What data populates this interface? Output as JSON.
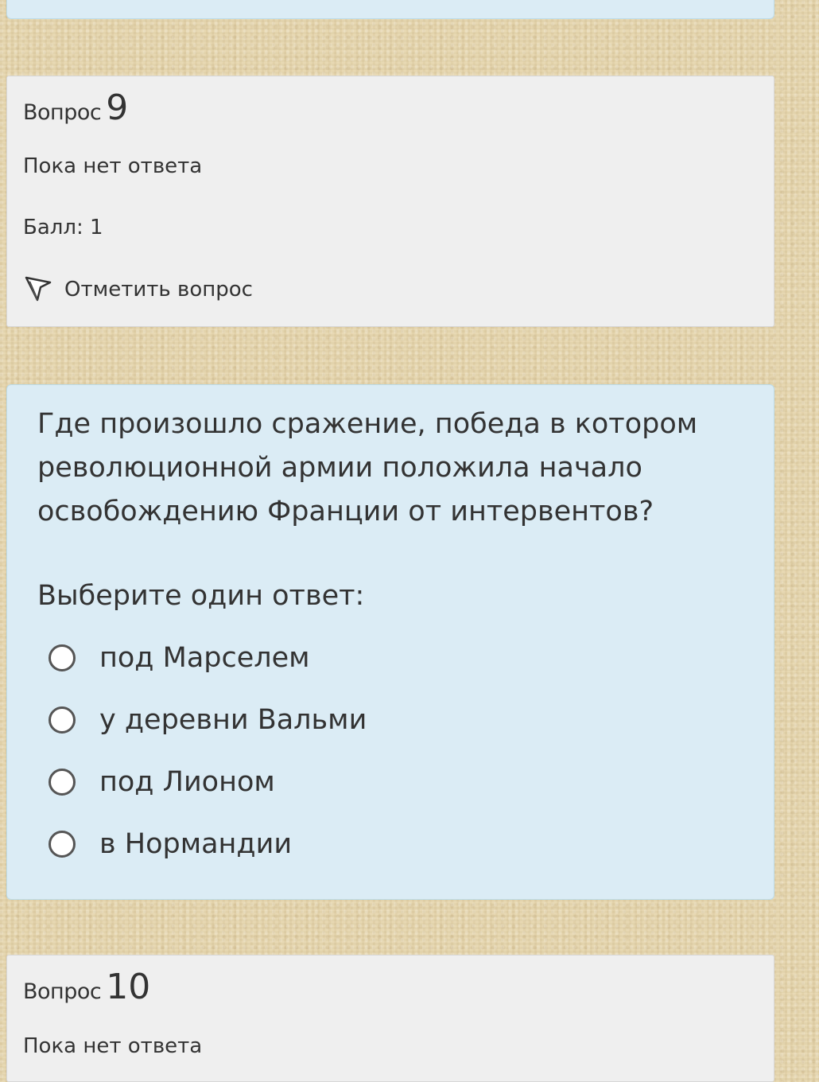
{
  "questions": [
    {
      "title_word": "Вопрос",
      "number": "9",
      "state": "Пока нет ответа",
      "grade": "Балл: 1",
      "flag_label": "Отметить вопрос",
      "text": "Где произошло сражение, победа в котором революционной армии положила начало освобождению Франции от интервентов?",
      "prompt": "Выберите один ответ:",
      "answers": [
        {
          "label": "под Марселем",
          "selected": false
        },
        {
          "label": "у деревни Вальми",
          "selected": false
        },
        {
          "label": "под Лионом",
          "selected": false
        },
        {
          "label": "в Нормандии",
          "selected": false
        }
      ]
    },
    {
      "title_word": "Вопрос",
      "number": "10",
      "state": "Пока нет ответа"
    }
  ],
  "colors": {
    "background": "#e6d5ac",
    "info_panel": "#efefef",
    "content_panel": "#dbecf5",
    "text": "#333333"
  },
  "icons": {
    "flag": "flag-icon",
    "radio": "radio-unchecked-icon"
  }
}
